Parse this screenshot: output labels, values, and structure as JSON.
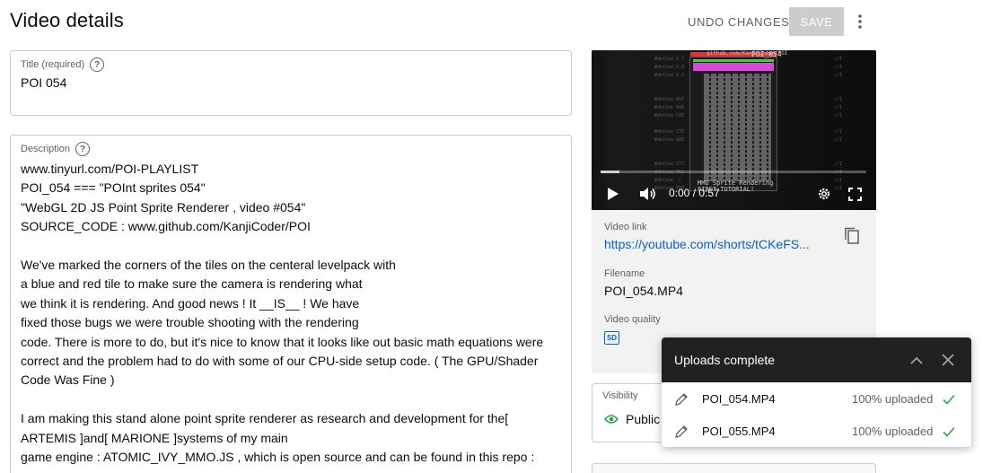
{
  "header": {
    "title": "Video details",
    "undo_label": "UNDO CHANGES",
    "save_label": "SAVE"
  },
  "title_field": {
    "label": "Title (required)",
    "value": "POI 054"
  },
  "description_field": {
    "label": "Description",
    "lines": [
      "www.tinyurl.com/POI-PLAYLIST",
      "POI_054 === \"POInt sprites 054\"",
      "\"WebGL 2D JS Point Sprite Renderer , video #054\"",
      "SOURCE_CODE : www.github.com/KanjiCoder/POI",
      "",
      "We've marked the corners of the tiles on the centeral levelpack with",
      "a blue and red tile to make sure the camera is rendering what",
      "we think it is rendering. And good news ! It __IS__ ! We have",
      "fixed those bugs we were trouble shooting with the rendering",
      "code. There is more to do, but it's nice to know that it looks like out basic math equations were",
      "correct and the problem had to do with some of our CPU-side setup code. ( The GPU/Shader Code Was Fine )",
      "",
      "I am making this stand alone point sprite renderer as research and development for the[ ARTEMIS ]and[ MARIONE ]systems of my main",
      "game engine : ATOMIC_IVY_MMO.JS , which is open source and can be found in this repo :"
    ]
  },
  "video": {
    "current_time": "0:00",
    "separator": " / ",
    "duration": "0:57",
    "progress": 0.07,
    "preview_caption": "MMO Sprite Rendering",
    "preview_caption2": "FIRST TUTORIAL!",
    "preview_top": "POI_054",
    "preview_window_caption": "github.com/KanjiCoder/POI"
  },
  "video_info": {
    "link_label": "Video link",
    "link_value": "https://youtube.com/shorts/tCKeFS...",
    "filename_label": "Filename",
    "filename_value": "POI_054.MP4",
    "quality_label": "Video quality",
    "quality_badge": "SD"
  },
  "visibility": {
    "label": "Visibility",
    "value": "Public"
  },
  "uploads_panel": {
    "title": "Uploads complete",
    "items": [
      {
        "filename": "POI_054.MP4",
        "status": "100% uploaded"
      },
      {
        "filename": "POI_055.MP4",
        "status": "100% uploaded"
      }
    ]
  },
  "colors": {
    "link": "#065fd4",
    "success": "#2ba640",
    "panel_header": "#212121",
    "save_disabled": "#cccccc"
  },
  "icons": [
    "more-vert-icon",
    "help-icon",
    "play-icon",
    "volume-icon",
    "settings-icon",
    "fullscreen-icon",
    "copy-icon",
    "eye-icon",
    "chevron-up-icon",
    "close-icon",
    "edit-icon",
    "check-icon"
  ]
}
